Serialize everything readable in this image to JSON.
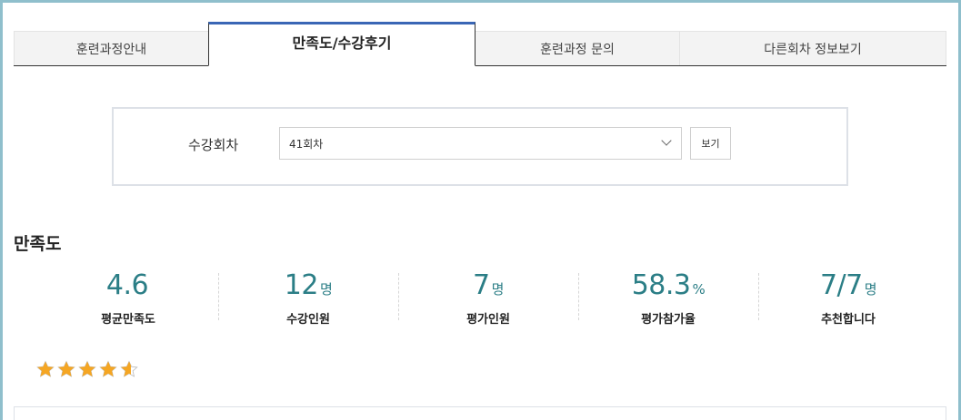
{
  "tabs": [
    {
      "label": "훈련과정안내",
      "active": false
    },
    {
      "label": "만족도/수강후기",
      "active": true
    },
    {
      "label": "훈련과정 문의",
      "active": false
    },
    {
      "label": "다른회차 정보보기",
      "active": false
    }
  ],
  "round_select": {
    "label": "수강회차",
    "value": "41회차",
    "button_label": "보기"
  },
  "satisfaction": {
    "title": "만족도",
    "stats": [
      {
        "value": "4.6",
        "unit": "",
        "label": "평균만족도"
      },
      {
        "value": "12",
        "unit": "명",
        "label": "수강인원"
      },
      {
        "value": "7",
        "unit": "명",
        "label": "평가인원"
      },
      {
        "value": "58.3",
        "unit": "%",
        "label": "평가참가율"
      },
      {
        "value": "7/7",
        "unit": "명",
        "label": "추천합니다"
      }
    ],
    "rating": 4.6,
    "rating_max": 5,
    "star_color": "#f5a623"
  }
}
